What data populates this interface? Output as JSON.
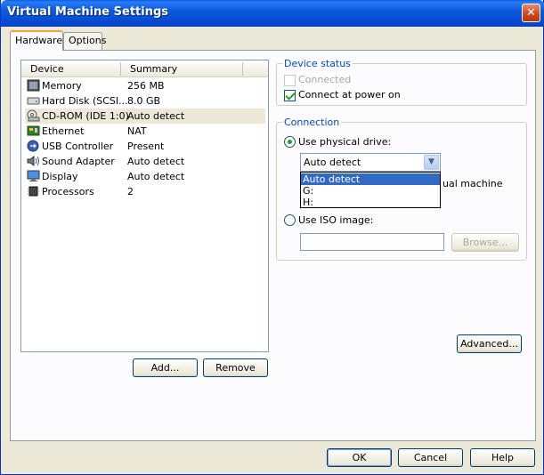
{
  "window": {
    "title": "Virtual Machine Settings",
    "close": "✕"
  },
  "tabs": [
    {
      "label": "Hardware"
    },
    {
      "label": "Options"
    }
  ],
  "device_list": {
    "columns": [
      "Device",
      "Summary"
    ],
    "rows": [
      {
        "name": "Memory",
        "summary": "256 MB",
        "icon": "memory-icon"
      },
      {
        "name": "Hard Disk (SCSI...",
        "summary": "8.0 GB",
        "icon": "hard-disk-icon"
      },
      {
        "name": "CD-ROM (IDE 1:0)",
        "summary": "Auto detect",
        "icon": "cdrom-icon"
      },
      {
        "name": "Ethernet",
        "summary": "NAT",
        "icon": "ethernet-icon"
      },
      {
        "name": "USB Controller",
        "summary": "Present",
        "icon": "usb-icon"
      },
      {
        "name": "Sound Adapter",
        "summary": "Auto detect",
        "icon": "sound-icon"
      },
      {
        "name": "Display",
        "summary": "Auto detect",
        "icon": "display-icon"
      },
      {
        "name": "Processors",
        "summary": "2",
        "icon": "processor-icon"
      }
    ],
    "selected": "CD-ROM (IDE 1:0)"
  },
  "list_buttons": {
    "add": "Add...",
    "remove": "Remove"
  },
  "device_status": {
    "label": "Device status",
    "connected": "Connected",
    "connect_at_power_on": "Connect at power on"
  },
  "connection": {
    "label": "Connection",
    "use_physical_drive": "Use physical drive:",
    "drive_value": "Auto detect",
    "drive_options": [
      "Auto detect",
      "G:",
      "H:"
    ],
    "hidden_text_fragment": "ual machine",
    "use_iso_image": "Use ISO image:",
    "iso_path": "",
    "browse": "Browse..."
  },
  "advanced": "Advanced...",
  "footer": {
    "ok": "OK",
    "cancel": "Cancel",
    "help": "Help"
  },
  "colors": {
    "titlebar": "#0b5bdc",
    "group_label": "#0046d5",
    "selection": "#316ac5"
  }
}
